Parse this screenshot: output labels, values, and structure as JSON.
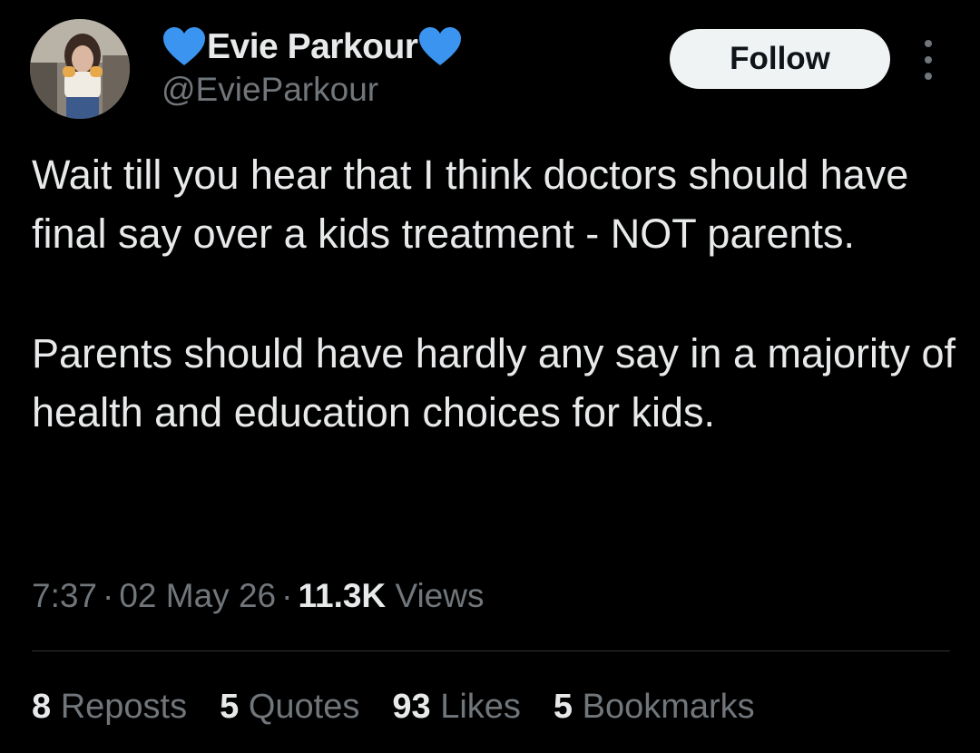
{
  "author": {
    "display_name": "Evie Parkour",
    "handle": "@EvieParkour",
    "name_decoration_icon": "blue-heart-emoji"
  },
  "actions": {
    "follow_label": "Follow",
    "more_icon": "more-vertical-icon"
  },
  "tweet": {
    "paragraphs": [
      "Wait till you hear that I think doctors should have final say over a kids treatment - NOT parents.",
      "Parents should have hardly any say in a majority of health and education choices for kids."
    ]
  },
  "meta": {
    "time": "7:37",
    "separator": "·",
    "date": "02 May 26",
    "views_count": "11.3K",
    "views_label": "Views"
  },
  "stats": [
    {
      "count": "8",
      "label": "Reposts"
    },
    {
      "count": "5",
      "label": "Quotes"
    },
    {
      "count": "93",
      "label": "Likes"
    },
    {
      "count": "5",
      "label": "Bookmarks"
    }
  ],
  "colors": {
    "background": "#000000",
    "text_primary": "#e7e9ea",
    "text_secondary": "#71767b",
    "heart": "#3b94f0",
    "follow_button_bg": "#eff3f4",
    "divider": "#2f3336"
  }
}
